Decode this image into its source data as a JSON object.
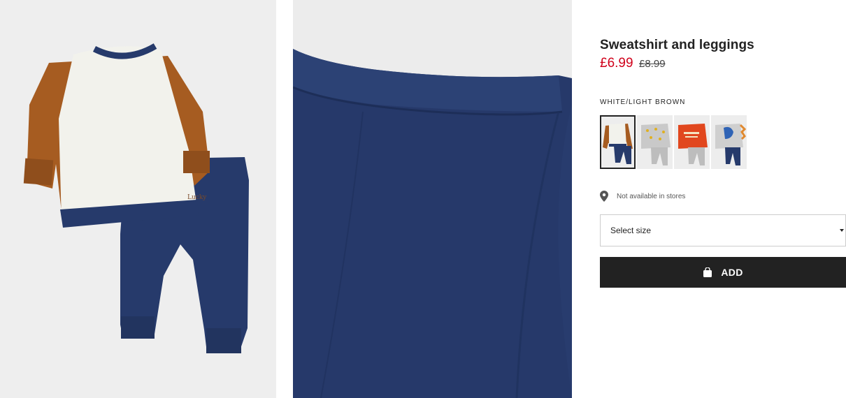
{
  "product": {
    "title": "Sweatshirt and leggings",
    "price_sale": "£6.99",
    "price_original": "£8.99",
    "color_label": "WHITE/LIGHT BROWN",
    "availability": "Not available in stores",
    "size_placeholder": "Select size",
    "add_label": "ADD"
  },
  "swatches": [
    {
      "name": "white-light-brown",
      "selected": true
    },
    {
      "name": "grey-print",
      "selected": false
    },
    {
      "name": "red-print",
      "selected": false
    },
    {
      "name": "grey-dinosaur",
      "selected": false
    }
  ],
  "icons": {
    "location": "map-pin-icon",
    "bag": "shopping-bag-icon",
    "caret": "chevron-down-icon"
  },
  "colors": {
    "sale_price": "#d0021b",
    "add_button": "#222222",
    "navy": "#263a6b",
    "tan": "#a65c21",
    "cream": "#f2f2ec"
  }
}
